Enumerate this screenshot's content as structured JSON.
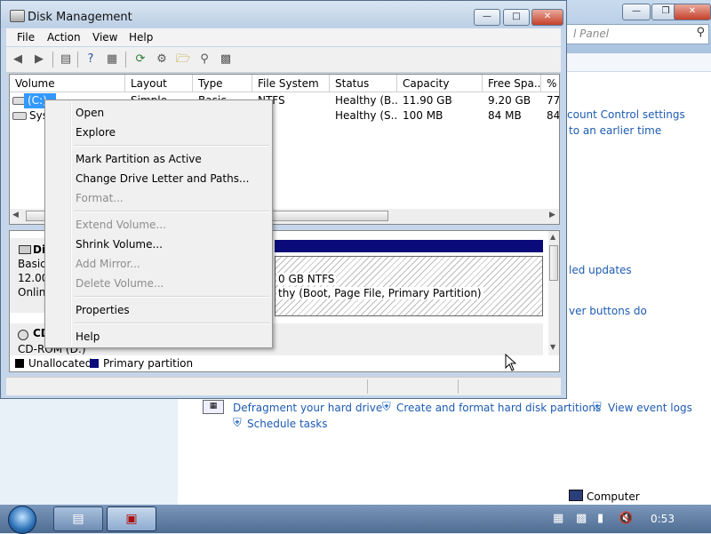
{
  "background_window": {
    "search_placeholder": "l Panel",
    "link_uac": "count Control settings",
    "link_restore": "to an earlier time",
    "link_updates": "led updates",
    "link_power": "ver buttons do",
    "link_defrag": "Defragment your hard drive",
    "link_create_format": "Create and format hard disk partitions",
    "link_event_logs": "View event logs",
    "link_schedule": "Schedule tasks",
    "status_computer": "Computer"
  },
  "window": {
    "title": "Disk Management",
    "menu": {
      "file": "File",
      "action": "Action",
      "view": "View",
      "help": "Help"
    }
  },
  "volume_list": {
    "headers": {
      "volume": "Volume",
      "layout": "Layout",
      "type": "Type",
      "filesystem": "File System",
      "status": "Status",
      "capacity": "Capacity",
      "free_space": "Free Spa...",
      "pct_free": "% F"
    },
    "rows": [
      {
        "volume": "(C:)",
        "layout": "Simple",
        "type": "Basic",
        "filesystem": "NTFS",
        "status": "Healthy (B...",
        "capacity": "11.90 GB",
        "free": "9.20 GB",
        "pct": "77"
      },
      {
        "volume": "Syst",
        "layout": "",
        "type": "",
        "filesystem": "FS",
        "status": "Healthy (S...",
        "capacity": "100 MB",
        "free": "84 MB",
        "pct": "84"
      }
    ]
  },
  "graphical": {
    "disk0": {
      "name": "Di",
      "type": "Basic",
      "size": "12.00",
      "state": "Onlin"
    },
    "partition": {
      "size": "0 GB NTFS",
      "status": "thy (Boot, Page File, Primary Partition)"
    },
    "cd": {
      "name": "CD",
      "desc": "CD-ROM (D:)"
    },
    "legend": {
      "unallocated": "Unallocated",
      "primary": "Primary partition"
    }
  },
  "context_menu": {
    "open": "Open",
    "explore": "Explore",
    "mark_active": "Mark Partition as Active",
    "change_letter": "Change Drive Letter and Paths...",
    "format": "Format...",
    "extend": "Extend Volume...",
    "shrink": "Shrink Volume...",
    "add_mirror": "Add Mirror...",
    "delete": "Delete Volume...",
    "properties": "Properties",
    "help": "Help"
  },
  "taskbar": {
    "clock": "0:53"
  },
  "colors": {
    "primary_partition": "#0a0a7a",
    "unallocated": "#000000"
  }
}
